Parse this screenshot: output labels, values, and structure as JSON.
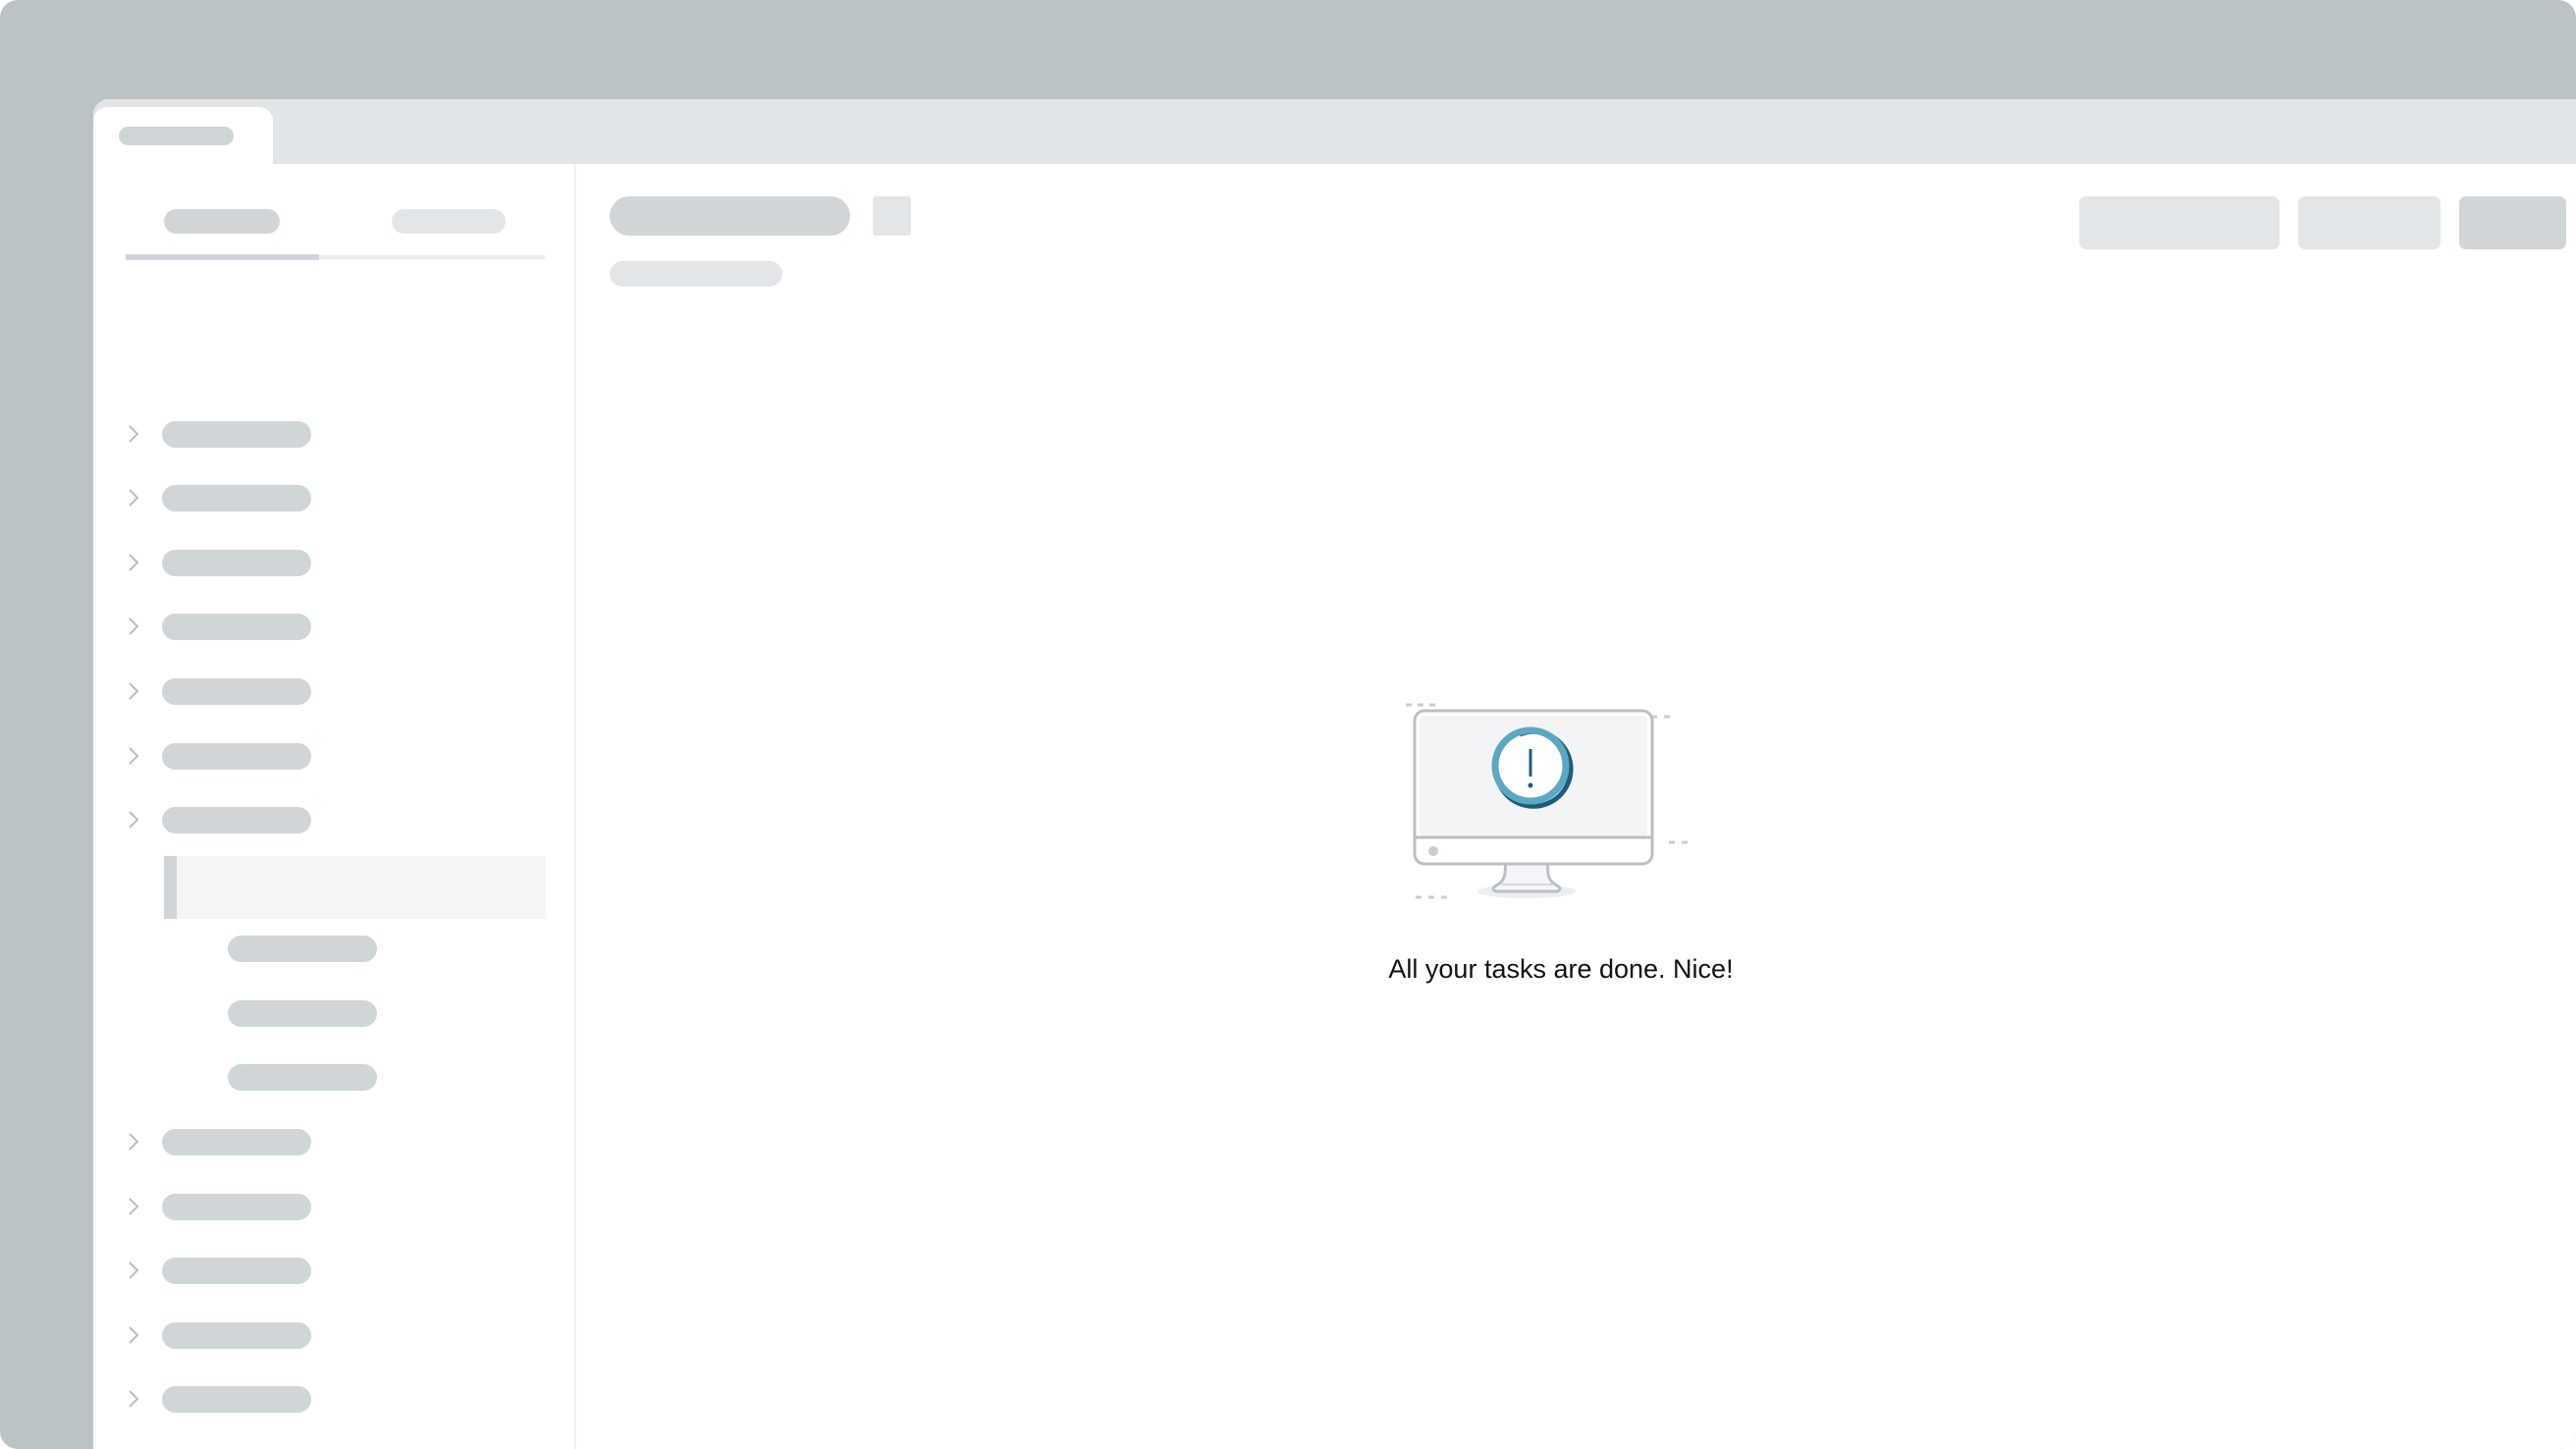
{
  "app": {
    "tabs": [
      {
        "label": "",
        "active": true
      }
    ]
  },
  "sidebar": {
    "tabs": [
      {
        "label": "",
        "active": true
      },
      {
        "label": "",
        "active": false
      }
    ],
    "tree": [
      {
        "label": "",
        "expanded": false,
        "icon": "chevron-right-icon"
      },
      {
        "label": "",
        "expanded": false,
        "icon": "chevron-right-icon"
      },
      {
        "label": "",
        "expanded": false,
        "icon": "chevron-right-icon"
      },
      {
        "label": "",
        "expanded": false,
        "icon": "chevron-right-icon"
      },
      {
        "label": "",
        "expanded": false,
        "icon": "chevron-right-icon"
      },
      {
        "label": "",
        "expanded": false,
        "icon": "chevron-right-icon"
      },
      {
        "label": "",
        "expanded": true,
        "icon": "chevron-right-icon",
        "children": [
          {
            "label": "",
            "selected": true
          },
          {
            "label": "",
            "selected": false
          },
          {
            "label": "",
            "selected": false
          },
          {
            "label": "",
            "selected": false
          }
        ]
      },
      {
        "label": "",
        "expanded": false,
        "icon": "chevron-right-icon"
      },
      {
        "label": "",
        "expanded": false,
        "icon": "chevron-right-icon"
      },
      {
        "label": "",
        "expanded": false,
        "icon": "chevron-right-icon"
      },
      {
        "label": "",
        "expanded": false,
        "icon": "chevron-right-icon"
      },
      {
        "label": "",
        "expanded": false,
        "icon": "chevron-right-icon"
      }
    ]
  },
  "main": {
    "title": "",
    "subtitle": "",
    "toolbar": {
      "buttons": [
        {
          "label": "",
          "icon": ""
        },
        {
          "label": "",
          "icon": ""
        },
        {
          "label": "",
          "icon": "",
          "primary": true
        },
        {
          "label": "",
          "icon": "more-icon"
        }
      ]
    },
    "empty_state": {
      "icon": "monitor-alert-icon",
      "message": "All your tasks are done. Nice!"
    }
  },
  "colors": {
    "frame_bg": "#bcc3c7",
    "skeleton": "#d0d5d8",
    "skeleton_light": "#e2e6e9",
    "accent": "#5aa8c4",
    "accent_dark": "#1d5d78"
  }
}
